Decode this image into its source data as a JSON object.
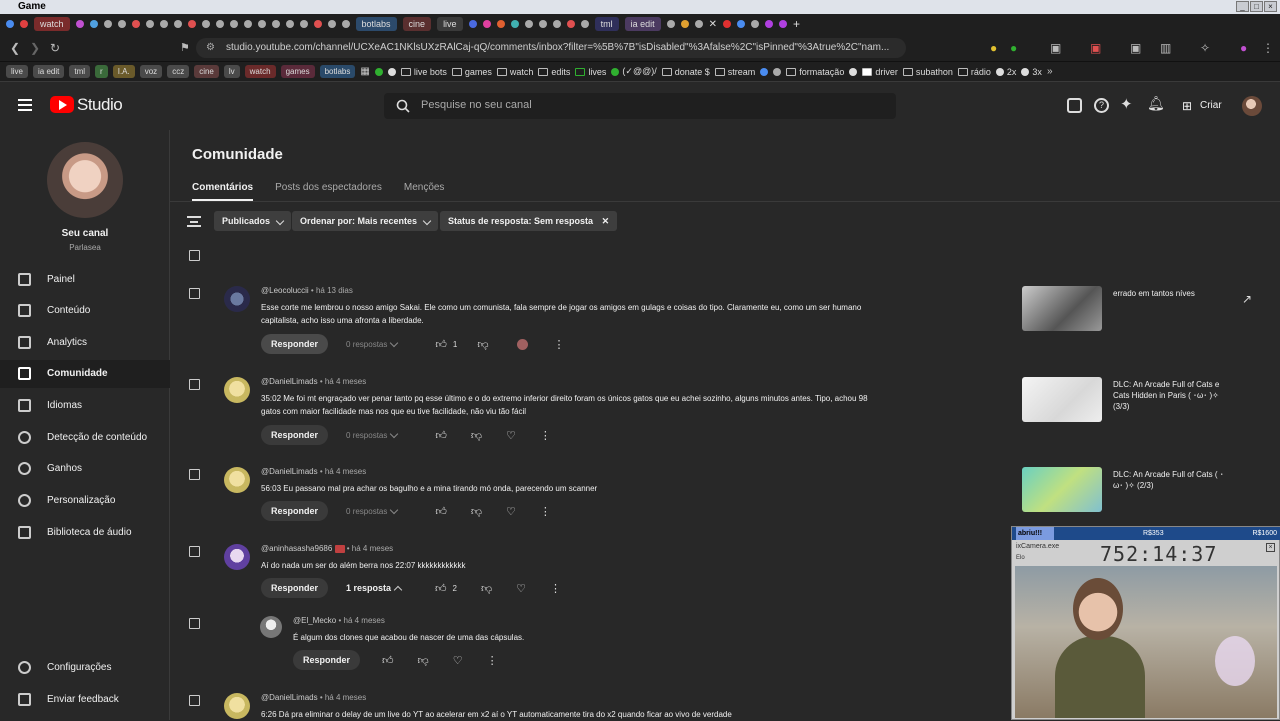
{
  "browser": {
    "window_title": "Game",
    "tabs": [
      "watch",
      "botlabs",
      "cine",
      "live",
      "tml",
      "ia edit"
    ],
    "url": "studio.youtube.com/channel/UCXeAC1NKlsUXzRAlCaj-qQ/comments/inbox?filter=%5B%7B\"isDisabled\"%3Afalse%2C\"isPinned\"%3Atrue%2C\"nam...",
    "bookmarks_chips": [
      "live",
      "ia edit",
      "tml",
      "r",
      "I.A.",
      "voz",
      "ccz",
      "cine",
      "lv",
      "watch",
      "games",
      "botlabs"
    ],
    "bookmarks_folders": [
      "live bots",
      "games",
      "watch",
      "edits",
      "lives",
      "(✓@@)/",
      "donate $",
      "stream",
      "formatação",
      "driver",
      "subathon",
      "rádio",
      "2x",
      "3x"
    ]
  },
  "header": {
    "logo_text": "Studio",
    "search_placeholder": "Pesquise no seu canal",
    "create_label": "Criar"
  },
  "sidebar": {
    "channel_name": "Seu canal",
    "channel_sub": "Parlasea",
    "items": [
      {
        "label": "Painel",
        "icon": "dashboard-icon"
      },
      {
        "label": "Conteúdo",
        "icon": "content-icon"
      },
      {
        "label": "Analytics",
        "icon": "analytics-icon"
      },
      {
        "label": "Comunidade",
        "icon": "community-icon"
      },
      {
        "label": "Idiomas",
        "icon": "subtitles-icon"
      },
      {
        "label": "Detecção de conteúdo",
        "icon": "copyright-icon"
      },
      {
        "label": "Ganhos",
        "icon": "earn-icon"
      },
      {
        "label": "Personalização",
        "icon": "customization-icon"
      },
      {
        "label": "Biblioteca de áudio",
        "icon": "audio-library-icon"
      }
    ],
    "bottom": [
      {
        "label": "Configurações",
        "icon": "settings-icon"
      },
      {
        "label": "Enviar feedback",
        "icon": "feedback-icon"
      }
    ]
  },
  "page": {
    "title": "Comunidade",
    "tabs": [
      "Comentários",
      "Posts dos espectadores",
      "Menções"
    ],
    "filters": [
      "Publicados",
      "Ordenar por: Mais recentes",
      "Status de resposta: Sem resposta"
    ]
  },
  "comments": [
    {
      "author": "@Leocoluccii",
      "time": "há 13 dias",
      "text": "Esse corte me lembrou o nosso amigo Sakai. Ele como um comunista, fala sempre de jogar os amigos em gulags e coisas do tipo. Claramente eu, como um ser humano capitalista, acho isso uma afronta a liberdade.",
      "reply_label": "Responder",
      "replies": "0 respostas",
      "likes": "1",
      "video_title": "errado em tantos níves"
    },
    {
      "author": "@DanielLimads",
      "time": "há 4 meses",
      "text": "35:02 Me foi mt engraçado ver penar tanto pq esse último e o do extremo inferior direito foram os únicos gatos que eu achei sozinho, alguns minutos antes. Tipo, achou 98 gatos com maior facilidade mas nos que eu tive facilidade, não viu tão fácil",
      "reply_label": "Responder",
      "replies": "0 respostas",
      "video_title": "DLC: An Arcade Full of Cats e Cats Hidden in Paris ( ･ω･ )✧ (3/3)"
    },
    {
      "author": "@DanielLimads",
      "time": "há 4 meses",
      "text": "56:03 Eu passano mal pra achar os bagulho e a mina tirando mó onda, parecendo um scanner",
      "reply_label": "Responder",
      "replies": "0 respostas",
      "video_title": "DLC: An Arcade Full of Cats ( ･ω･ )✧ (2/3)"
    },
    {
      "author": "@aninhasasha9686",
      "time": "há 4 meses",
      "text": "Aí do nada um ser do além berra nos 22:07 kkkkkkkkkkkk",
      "reply_label": "Responder",
      "replies": "1 resposta",
      "likes": "2"
    },
    {
      "author": "@El_Mecko",
      "time": "há 4 meses",
      "text": "É algum dos clones que acabou de nascer de uma das cápsulas.",
      "reply_label": "Responder"
    },
    {
      "author": "@DanielLimads",
      "time": "há 4 meses",
      "text": "6:26 Dá pra eliminar o delay de um live do YT ao acelerar em x2 aí o YT automaticamente tira do x2 quando ficar ao vivo de verdade"
    }
  ],
  "overlay": {
    "left_label": "abriu!!!",
    "mid_label": "R$353",
    "right_label": "R$1600",
    "window_title": "ixCamera.exe",
    "sub_label": "Elo",
    "timer": "752:14:37"
  }
}
